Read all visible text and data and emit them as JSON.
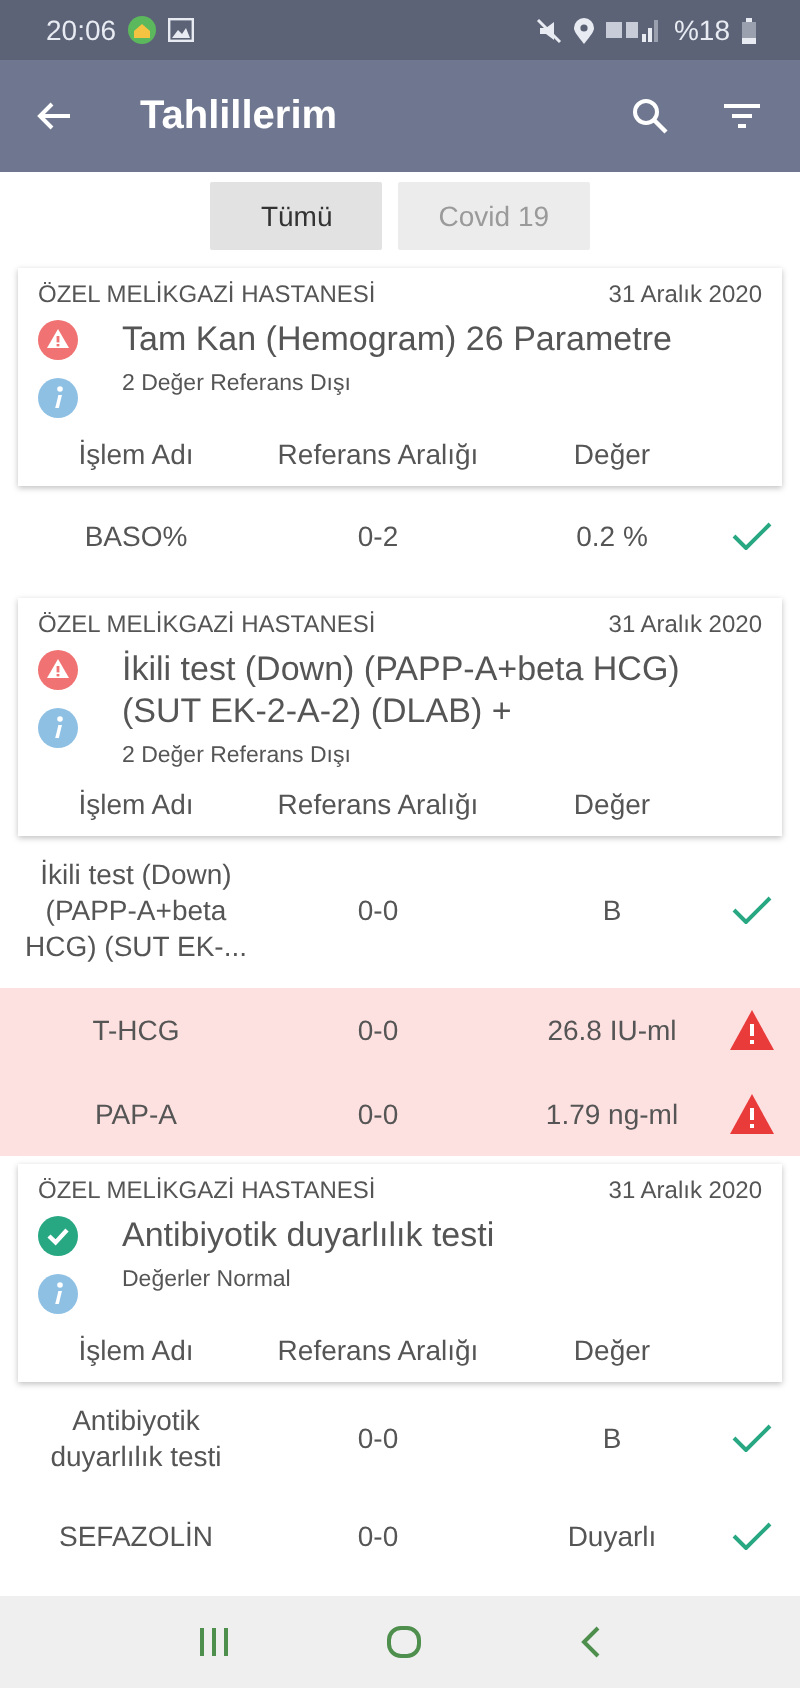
{
  "status_bar": {
    "time": "20:06",
    "battery": "%18"
  },
  "app_bar": {
    "title": "Tahlillerim"
  },
  "filters": [
    {
      "label": "Tümü",
      "selected": true
    },
    {
      "label": "Covid 19",
      "selected": false
    }
  ],
  "results": [
    {
      "hospital": "ÖZEL MELİKGAZİ HASTANESİ",
      "date": "31 Aralık 2020",
      "kind": "alert",
      "title": "Tam Kan (Hemogram) 26 Parametre",
      "summary": "2 Değer Referans Dışı",
      "columns": [
        "İşlem Adı",
        "Referans Aralığı",
        "Değer"
      ],
      "rows": [
        {
          "name": "BASO%",
          "range": "0-2",
          "value": "0.2 %",
          "out_of_range": false
        }
      ]
    },
    {
      "hospital": "ÖZEL MELİKGAZİ HASTANESİ",
      "date": "31 Aralık 2020",
      "kind": "alert",
      "title": "İkili test (Down) (PAPP-A+beta HCG) (SUT EK-2-A-2) (DLAB) +",
      "summary": "2 Değer Referans Dışı",
      "columns": [
        "İşlem Adı",
        "Referans Aralığı",
        "Değer"
      ],
      "rows": [
        {
          "name": "İkili test (Down) (PAPP-A+beta HCG) (SUT EK-...",
          "range": "0-0",
          "value": "B",
          "out_of_range": false
        },
        {
          "name": "T-HCG",
          "range": "0-0",
          "value": "26.8 IU-ml",
          "out_of_range": true
        },
        {
          "name": "PAP-A",
          "range": "0-0",
          "value": "1.79 ng-ml",
          "out_of_range": true
        }
      ]
    },
    {
      "hospital": "ÖZEL MELİKGAZİ HASTANESİ",
      "date": "31 Aralık 2020",
      "kind": "normal",
      "title": "Antibiyotik duyarlılık testi",
      "summary": "Değerler Normal",
      "columns": [
        "İşlem Adı",
        "Referans Aralığı",
        "Değer"
      ],
      "rows": [
        {
          "name": "Antibiyotik duyarlılık testi",
          "range": "0-0",
          "value": "B",
          "out_of_range": false
        },
        {
          "name": "SEFAZOLİN",
          "range": "0-0",
          "value": "Duyarlı",
          "out_of_range": false
        }
      ]
    }
  ]
}
